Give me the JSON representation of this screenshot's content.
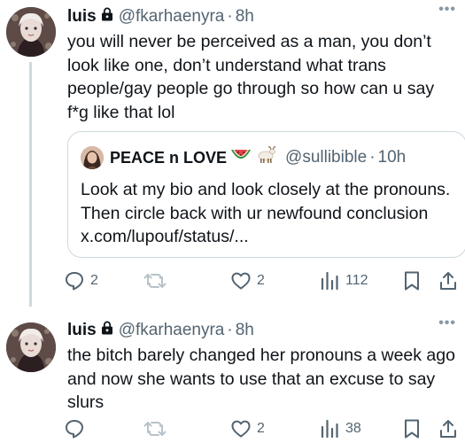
{
  "tweets": [
    {
      "display_name": "luis",
      "handle": "@fkarhaenyra",
      "separator": "·",
      "time": "8h",
      "more": "•••",
      "text": "you will never be perceived as a man, you don’t look like one, don’t understand what trans people/gay people go through so how can u say f*g like that lol",
      "quote": {
        "display_name": "PEACE n LOVE",
        "emojis": [
          "watermelon-emoji",
          "goat-emoji"
        ],
        "handle": "@sullibible",
        "separator": "·",
        "time": "10h",
        "text": "Look at my bio and look closely at the pronouns. Then circle back with ur newfound conclusion x.com/lupouf/status/..."
      },
      "actions": {
        "replies": "2",
        "retweets": "",
        "likes": "2",
        "views": "112"
      }
    },
    {
      "display_name": "luis",
      "handle": "@fkarhaenyra",
      "separator": "·",
      "time": "8h",
      "more": "•••",
      "text": "the bitch barely changed her pronouns a week ago and now she wants to use that an excuse to say slurs",
      "actions": {
        "replies": "",
        "retweets": "",
        "likes": "2",
        "views": "38"
      }
    }
  ],
  "colors": {
    "text": "#0f1419",
    "secondary": "#536471",
    "border": "#cfd9de",
    "retweet_icon": "#b8c2c9"
  }
}
